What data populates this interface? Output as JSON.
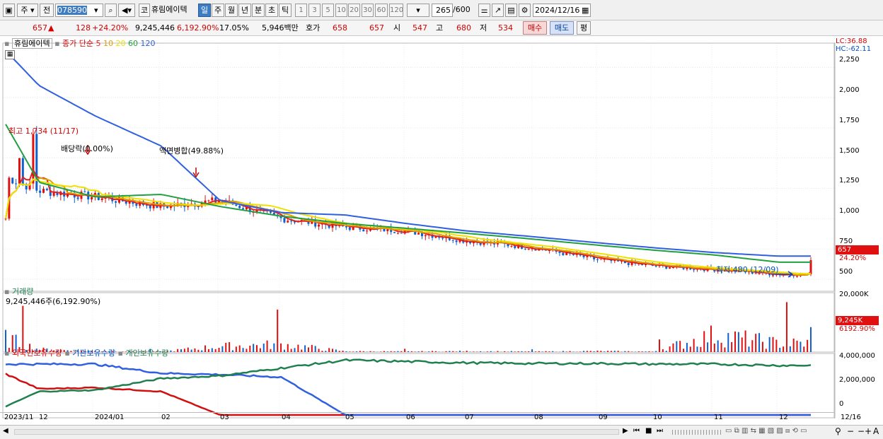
{
  "toolbar": {
    "market_label": "주",
    "all_label": "전",
    "code": "078590",
    "name_prefix": "코",
    "stock_name": "휴림에이텍",
    "periods": [
      "일",
      "주",
      "월",
      "년",
      "분",
      "초",
      "틱"
    ],
    "active_period": "일",
    "intervals": [
      "1",
      "3",
      "5",
      "10",
      "20",
      "30",
      "60",
      "120"
    ],
    "count": "265",
    "count_max": "/600",
    "date": "2024/12/16"
  },
  "quote": {
    "price": "657",
    "arrow": "▲",
    "change": "128",
    "change_pct": "+24.20%",
    "volume": "9,245,446",
    "volume_pct": "6,192.90%",
    "turnover": "17.05%",
    "amount": "5,946백만",
    "hoga_label": "호가",
    "ask": "658",
    "bid": "657",
    "open_label": "시",
    "open": "547",
    "high_label": "고",
    "high": "680",
    "low_label": "저",
    "low": "534",
    "buy_label": "매수",
    "sell_label": "매도",
    "eval_label": "평"
  },
  "price_panel": {
    "stock_label": "휴림에이텍",
    "legend_prefix": "종가 단순",
    "ma_periods": [
      "5",
      "10",
      "20",
      "60",
      "120"
    ],
    "ma_colors": [
      "#e02020",
      "#e0a000",
      "#f0e000",
      "#20a040",
      "#3060e0"
    ],
    "lc": "LC:36.88",
    "hc": "HC:-62.11",
    "high_note": "최고 1,734 (11/17)",
    "dividend_note": "배당락(0.00%)",
    "split_note": "액면병합(49.88%)",
    "low_note": "최저 480 (12/09)",
    "price_ticks": [
      "2,250",
      "2,000",
      "1,750",
      "1,500",
      "1,250",
      "1,000",
      "750",
      "500"
    ],
    "last_price": "657",
    "last_pct": "24.20%"
  },
  "volume_panel": {
    "label": "거래량",
    "value_text": "9,245,446주(6,192.90%)",
    "ticks": [
      "20,000K",
      "10,000K"
    ],
    "last_vol": "9,245K",
    "last_pct": "6192.90%"
  },
  "holding_panel": {
    "series": [
      "외국인보유수량",
      "기관보유수량",
      "개인보유수량"
    ],
    "colors": [
      "#d01010",
      "#3060e0",
      "#208050"
    ],
    "ticks": [
      "4,000,000",
      "2,000,000",
      "0"
    ]
  },
  "x_axis": {
    "labels": [
      "2023/11",
      "12",
      "2024/01",
      "02",
      "03",
      "04",
      "05",
      "06",
      "07",
      "08",
      "09",
      "10",
      "11",
      "12",
      "12/16"
    ]
  },
  "chart_data": {
    "type": "candlestick",
    "x": [
      "2023/11",
      "12",
      "2024/01",
      "02",
      "03",
      "04",
      "05",
      "06",
      "07",
      "08",
      "09",
      "10",
      "11",
      "12"
    ],
    "close_approx": [
      1350,
      1230,
      1180,
      1100,
      1150,
      1000,
      930,
      900,
      820,
      760,
      660,
      610,
      580,
      540
    ],
    "ma120_approx": [
      2400,
      2100,
      1850,
      1600,
      1150,
      1050,
      1030,
      960,
      900,
      850,
      800,
      760,
      720,
      690
    ],
    "ma60_approx": [
      1800,
      1300,
      1180,
      1200,
      1100,
      1020,
      960,
      920,
      880,
      830,
      780,
      740,
      700,
      640
    ],
    "volume_k_approx": [
      15000,
      3000,
      1000,
      500,
      6000,
      8000,
      800,
      600,
      900,
      500,
      1000,
      500,
      18000,
      9245
    ],
    "ylim": [
      400,
      2450
    ],
    "highest": {
      "value": 1734,
      "date": "11/17"
    },
    "lowest": {
      "value": 480,
      "date": "12/09"
    }
  }
}
